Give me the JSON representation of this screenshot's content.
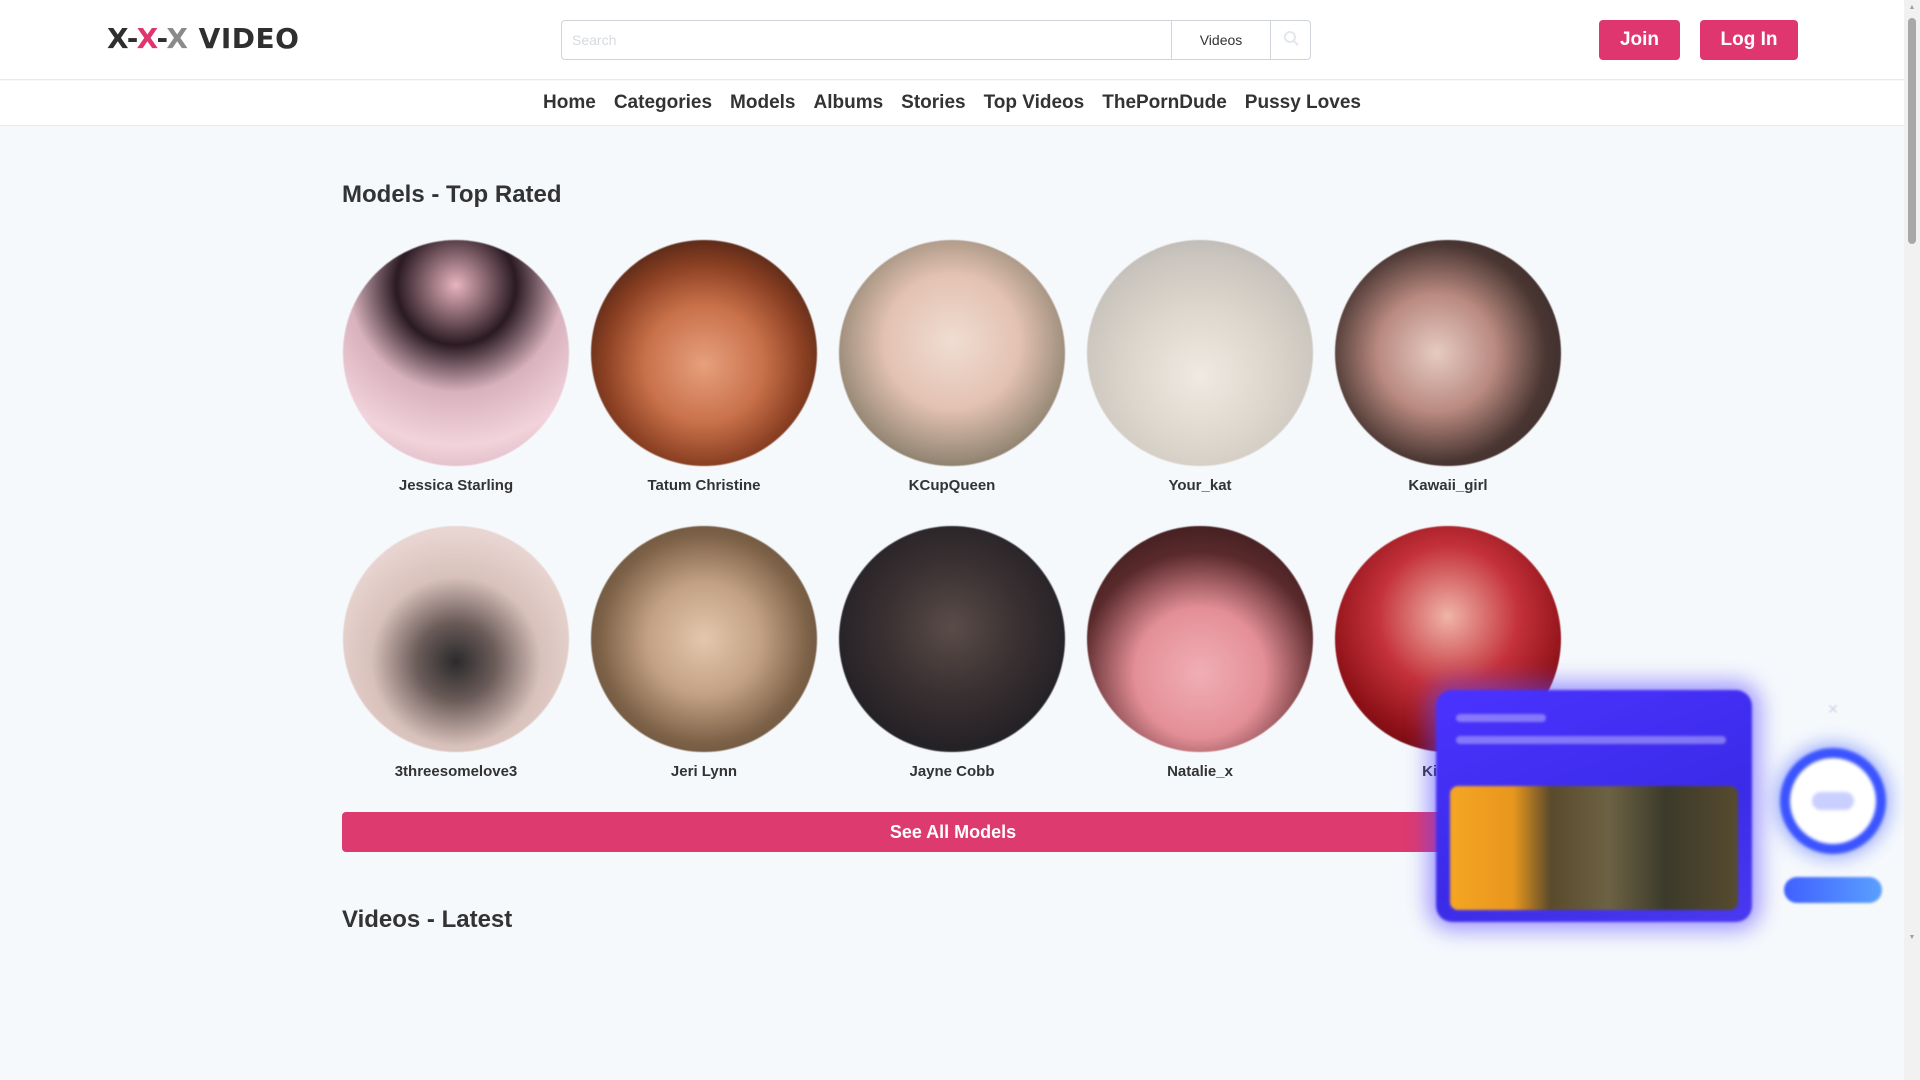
{
  "header": {
    "logo": {
      "part1": "X-",
      "part2": "X",
      "part3": "-",
      "part4": "X",
      "part5": " VIDEO"
    },
    "search": {
      "placeholder": "Search",
      "type_label": "Videos"
    },
    "join_label": "Join",
    "login_label": "Log In"
  },
  "nav": {
    "items": [
      {
        "label": "Home"
      },
      {
        "label": "Categories"
      },
      {
        "label": "Models"
      },
      {
        "label": "Albums"
      },
      {
        "label": "Stories"
      },
      {
        "label": "Top Videos"
      },
      {
        "label": "ThePornDude"
      },
      {
        "label": "Pussy Loves"
      }
    ]
  },
  "models_section": {
    "title": "Models - Top Rated",
    "models": [
      {
        "name": "Jessica Starling"
      },
      {
        "name": "Tatum Christine"
      },
      {
        "name": "KCupQueen"
      },
      {
        "name": "Your_kat"
      },
      {
        "name": "Kawaii_girl"
      },
      {
        "name": "3threesomelove3"
      },
      {
        "name": "Jeri Lynn"
      },
      {
        "name": "Jayne Cobb"
      },
      {
        "name": "Natalie_x"
      },
      {
        "name": "Kimber"
      }
    ],
    "see_all_label": "See All Models"
  },
  "videos_section": {
    "title": "Videos - Latest"
  },
  "colors": {
    "accent": "#e0366f",
    "page_background": "#f6f9fc",
    "ad_blue": "#3b2be8"
  },
  "icons": {
    "search_button": "search-icon",
    "ad_close": "close-icon"
  }
}
